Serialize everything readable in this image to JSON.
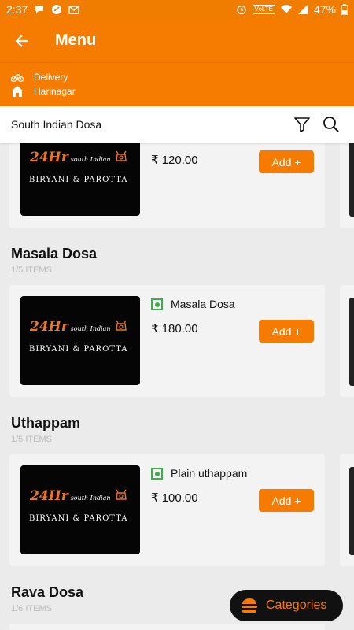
{
  "status": {
    "time": "2:37",
    "battery": "47%",
    "network": "VoLTE"
  },
  "header": {
    "title": "Menu"
  },
  "location": {
    "mode": "Delivery",
    "area": "Harinagar"
  },
  "search": {
    "query": "South Indian Dosa"
  },
  "restaurant_logo": {
    "line1_big": "24Hr",
    "line1_small": "south Indian",
    "line2": "BIRYANI & PAROTTA"
  },
  "sections": [
    {
      "title": "",
      "count": "",
      "item": {
        "name": "",
        "price": "₹ 120.00",
        "add_label": "Add +"
      }
    },
    {
      "title": "Masala Dosa",
      "count": "1/5 ITEMS",
      "item": {
        "name": "Masala Dosa",
        "price": "₹ 180.00",
        "add_label": "Add +"
      }
    },
    {
      "title": "Uthappam",
      "count": "1/5 ITEMS",
      "item": {
        "name": "Plain uthappam",
        "price": "₹ 100.00",
        "add_label": "Add +"
      }
    },
    {
      "title": "Rava Dosa",
      "count": "1/6 ITEMS"
    }
  ],
  "categories_button": {
    "label": "Categories"
  },
  "colors": {
    "brand": "#f57c00",
    "veg": "#3cae49",
    "dark_pill": "#111111"
  }
}
